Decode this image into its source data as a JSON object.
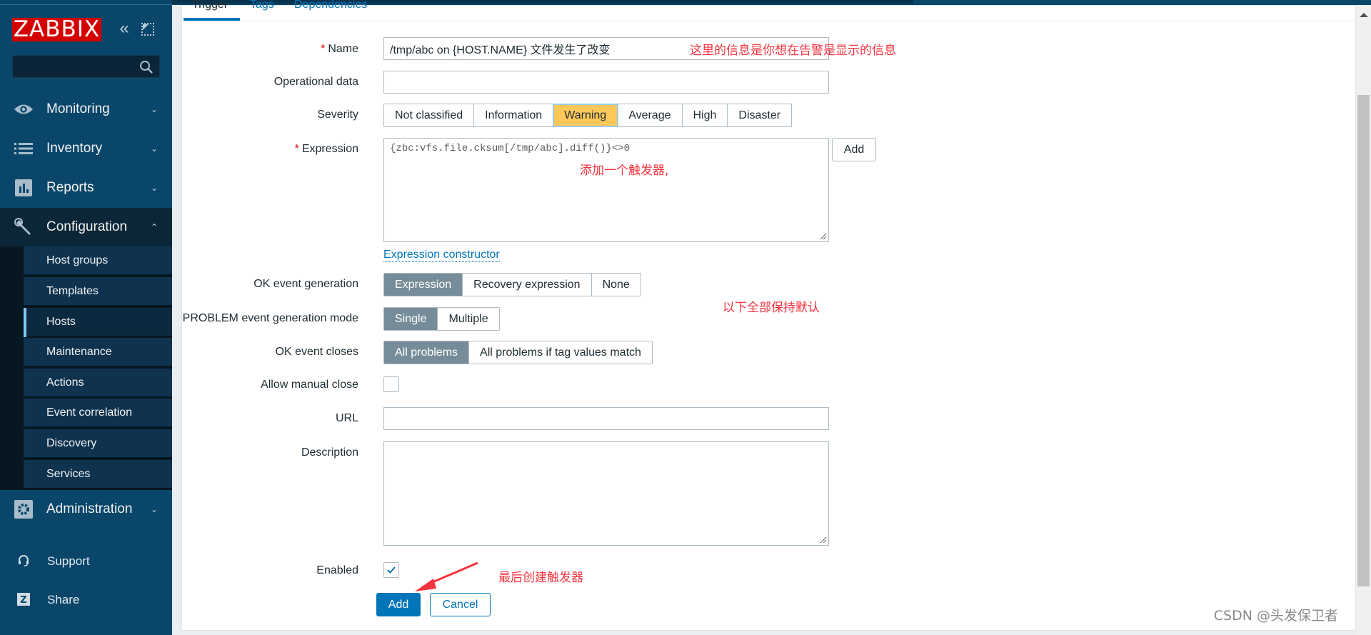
{
  "sidebar": {
    "logo": "ZABBIX",
    "collapse_icon": "double-chevron-left-icon",
    "kiosk_icon": "kiosk-mode-icon",
    "search": {
      "placeholder": "",
      "value": "",
      "icon": "search-icon"
    },
    "menu": [
      {
        "label": "Monitoring",
        "icon": "eye-icon",
        "expanded": false
      },
      {
        "label": "Inventory",
        "icon": "list-icon",
        "expanded": false
      },
      {
        "label": "Reports",
        "icon": "bar-chart-icon",
        "expanded": false
      },
      {
        "label": "Configuration",
        "icon": "wrench-icon",
        "expanded": true
      },
      {
        "label": "Administration",
        "icon": "gear-icon",
        "expanded": false
      }
    ],
    "submenu": [
      {
        "label": "Host groups"
      },
      {
        "label": "Templates"
      },
      {
        "label": "Hosts",
        "selected": true
      },
      {
        "label": "Maintenance"
      },
      {
        "label": "Actions"
      },
      {
        "label": "Event correlation"
      },
      {
        "label": "Discovery"
      },
      {
        "label": "Services"
      }
    ],
    "bottom": [
      {
        "label": "Support",
        "icon": "headset-icon"
      },
      {
        "label": "Share",
        "icon": "share-z-icon"
      }
    ]
  },
  "tabs": [
    {
      "label": "Trigger",
      "active": true
    },
    {
      "label": "Tags"
    },
    {
      "label": "Dependencies"
    }
  ],
  "form": {
    "name": {
      "label": "Name",
      "required": true,
      "value": "/tmp/abc on {HOST.NAME} 文件发生了改变"
    },
    "operational_data": {
      "label": "Operational data",
      "value": ""
    },
    "severity": {
      "label": "Severity",
      "options": [
        "Not classified",
        "Information",
        "Warning",
        "Average",
        "High",
        "Disaster"
      ],
      "selected": "Warning",
      "selected_color": "#ffc859"
    },
    "expression": {
      "label": "Expression",
      "required": true,
      "value": "{zbc:vfs.file.cksum[/tmp/abc].diff()}<>0",
      "add_button": "Add",
      "constructor_link": "Expression constructor"
    },
    "ok_event_generation": {
      "label": "OK event generation",
      "options": [
        "Expression",
        "Recovery expression",
        "None"
      ],
      "selected": "Expression"
    },
    "problem_mode": {
      "label": "PROBLEM event generation mode",
      "options": [
        "Single",
        "Multiple"
      ],
      "selected": "Single"
    },
    "ok_event_closes": {
      "label": "OK event closes",
      "options": [
        "All problems",
        "All problems if tag values match"
      ],
      "selected": "All problems"
    },
    "allow_manual_close": {
      "label": "Allow manual close",
      "checked": false
    },
    "url": {
      "label": "URL",
      "value": ""
    },
    "description": {
      "label": "Description",
      "value": ""
    },
    "enabled": {
      "label": "Enabled",
      "checked": true
    },
    "buttons": {
      "add": "Add",
      "cancel": "Cancel"
    }
  },
  "annotations": {
    "name_note": "这里的信息是你想在告警是显示的信息",
    "expression_note": "添加一个触发器,",
    "defaults_note": "以下全部保持默认",
    "final_note": "最后创建触发器",
    "accent_color": "#f5333f"
  },
  "watermark": "CSDN @头发保卫者"
}
